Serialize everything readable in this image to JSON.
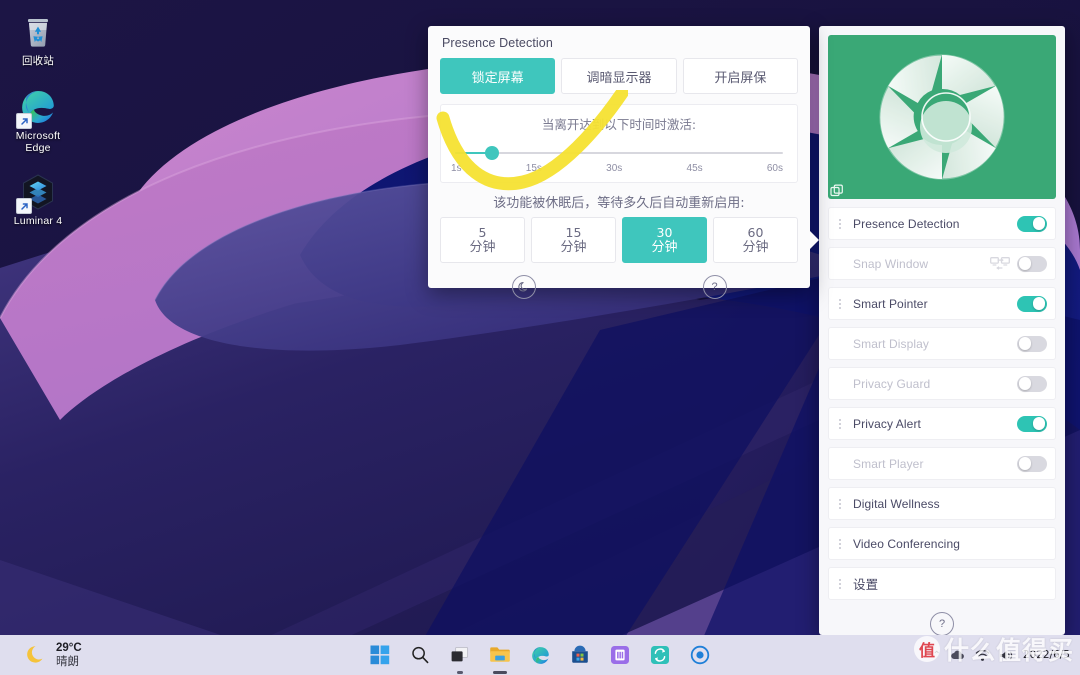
{
  "desktop": {
    "icons": [
      {
        "label": "回收站",
        "icon": "recycle-bin-icon",
        "shortcut": false
      },
      {
        "label": "Microsoft Edge",
        "icon": "microsoft-edge-icon",
        "shortcut": true
      },
      {
        "label": "Luminar 4",
        "icon": "luminar-4-icon",
        "shortcut": true
      }
    ]
  },
  "presence_popup": {
    "title": "Presence Detection",
    "actions": [
      {
        "label": "锁定屏幕",
        "selected": true
      },
      {
        "label": "调暗显示器",
        "selected": false
      },
      {
        "label": "开启屏保",
        "selected": false
      }
    ],
    "slider": {
      "caption": "当离开达到以下时间时激活:",
      "ticks": [
        "1s",
        "15s",
        "30s",
        "45s",
        "60s"
      ],
      "value_percent": 10
    },
    "resume": {
      "caption": "该功能被休眠后，等待多久后自动重新启用:",
      "options": [
        {
          "value": "5",
          "unit": "分钟",
          "selected": false
        },
        {
          "value": "15",
          "unit": "分钟",
          "selected": false
        },
        {
          "value": "30",
          "unit": "分钟",
          "selected": true
        },
        {
          "value": "60",
          "unit": "分钟",
          "selected": false
        }
      ]
    },
    "footer": [
      {
        "icon": "moon-icon",
        "glyph": "☾"
      },
      {
        "icon": "help-question-icon",
        "glyph": "?"
      }
    ]
  },
  "right_panel": {
    "hero": {
      "icon": "camera-shutter-icon",
      "badge_icon": "copy-icon",
      "bg_color": "#3aa876"
    },
    "features": [
      {
        "label": "Presence Detection",
        "enabled": true,
        "dimmed": false,
        "grip": true,
        "extra_icon": null
      },
      {
        "label": "Snap Window",
        "enabled": false,
        "dimmed": true,
        "grip": false,
        "extra_icon": "snap-window-icon"
      },
      {
        "label": "Smart Pointer",
        "enabled": true,
        "dimmed": false,
        "grip": true,
        "extra_icon": null
      },
      {
        "label": "Smart Display",
        "enabled": false,
        "dimmed": true,
        "grip": false,
        "extra_icon": null
      },
      {
        "label": "Privacy Guard",
        "enabled": false,
        "dimmed": true,
        "grip": false,
        "extra_icon": null
      },
      {
        "label": "Privacy Alert",
        "enabled": true,
        "dimmed": false,
        "grip": true,
        "extra_icon": null
      },
      {
        "label": "Smart Player",
        "enabled": false,
        "dimmed": true,
        "grip": false,
        "extra_icon": null
      },
      {
        "label": "Digital Wellness",
        "enabled": null,
        "dimmed": false,
        "grip": true,
        "extra_icon": null
      },
      {
        "label": "Video Conferencing",
        "enabled": null,
        "dimmed": false,
        "grip": true,
        "extra_icon": null
      },
      {
        "label": "设置",
        "enabled": null,
        "dimmed": false,
        "grip": true,
        "extra_icon": null
      }
    ],
    "footer": {
      "icon": "help-question-icon",
      "glyph": "?"
    }
  },
  "taskbar": {
    "weather": {
      "icon": "moon-weather-icon",
      "temperature": "29°C",
      "condition": "晴朗"
    },
    "apps": [
      {
        "name": "start-button",
        "icon": "windows-start-icon",
        "running": false
      },
      {
        "name": "search-button",
        "icon": "search-icon",
        "running": false
      },
      {
        "name": "task-view-button",
        "icon": "task-view-icon",
        "running": true
      },
      {
        "name": "file-explorer",
        "icon": "file-explorer-icon",
        "running": true
      },
      {
        "name": "microsoft-edge",
        "icon": "microsoft-edge-icon",
        "running": false
      },
      {
        "name": "microsoft-store",
        "icon": "microsoft-store-icon",
        "running": false
      },
      {
        "name": "purple-app",
        "icon": "purple-app-icon",
        "running": false
      },
      {
        "name": "sync-app",
        "icon": "sync-app-icon",
        "running": false
      },
      {
        "name": "target-app",
        "icon": "target-app-icon",
        "running": false
      }
    ],
    "tray": {
      "chevron": "⌃",
      "icons": [
        "cloud-icon",
        "network-icon",
        "volume-icon"
      ],
      "date": "2022/6/5",
      "time": ""
    }
  },
  "watermark": {
    "badge": "值",
    "text": "什么值得买"
  },
  "colors": {
    "accent_teal": "#3fc6bd",
    "toggle_on": "#2ec4b4",
    "hero_green": "#3aa876",
    "annotation_yellow": "#f5e131",
    "taskbar_bg": "#dfdeee",
    "wallpaper_navy": "#191240",
    "wallpaper_pink": "#c47cc4",
    "wallpaper_blue": "#121a72"
  }
}
